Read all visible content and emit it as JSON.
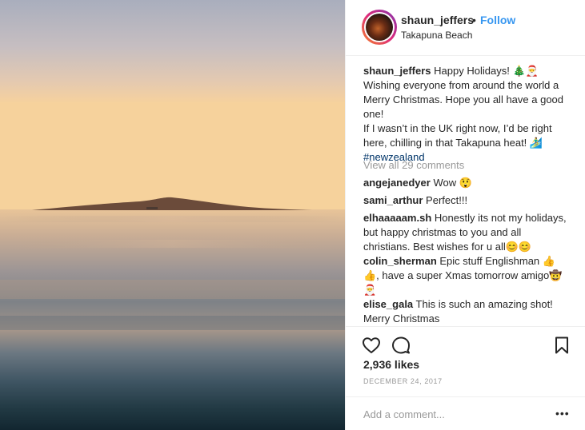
{
  "post": {
    "username": "shaun_jeffers",
    "separator": "•",
    "follow_label": "Follow",
    "location": "Takapuna Beach",
    "caption": {
      "username": "shaun_jeffers",
      "line1": "Happy Holidays! 🎄🎅",
      "line2": "Wishing everyone from around the world a",
      "line3": "Merry Christmas. Hope you all have a good",
      "line4": "one!",
      "line5": "If I wasn’t in the UK right now, I’d be right",
      "line6": "here, chilling in that Takapuna heat! 🏄‍♂",
      "hashtag": "#newzealand"
    },
    "view_all_comments": "View all 29 comments",
    "comments": [
      {
        "username": "angejanedyer",
        "text": "Wow 😲"
      },
      {
        "username": "sami_arthur",
        "text": "Perfect!!!"
      },
      {
        "username": "elhaaaaam.sh",
        "text": "Honestly its not my holidays,",
        "line2": "but happy christmas to you and all",
        "line3": "christians. Best wishes for u all😊😊"
      },
      {
        "username": "colin_sherman",
        "text": "Epic stuff Englishman 👍",
        "line2": "👍, have a super Xmas tomorrow amigo🤠",
        "line3": "🎅"
      },
      {
        "username": "elise_gala",
        "text": "This is such an amazing shot!",
        "line2": "Merry Christmas"
      }
    ],
    "likes": "2,936 likes",
    "date": "DECEMBER 24, 2017",
    "add_comment_placeholder": "Add a comment...",
    "more_label": "•••"
  },
  "icons": {
    "like": "heart-icon",
    "comment": "comment-icon",
    "save": "bookmark-icon"
  },
  "colors": {
    "link_blue": "#3897f0",
    "hashtag": "#003569",
    "muted": "#999999",
    "text": "#262626"
  }
}
